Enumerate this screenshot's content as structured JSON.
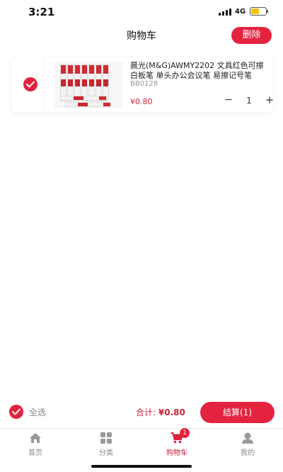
{
  "status_bar": {
    "time": "3:21",
    "network": "4G",
    "battery_level": 0.55,
    "battery_color": "#f2c200"
  },
  "header": {
    "title": "购物车",
    "delete_label": "删除"
  },
  "cart": {
    "items": [
      {
        "selected": true,
        "name": "晨光(M&G)AWMY2202 文具红色可擦白板笔 单头办公会议笔 易擦记号笔",
        "sku": "BB0128",
        "price_symbol": "¥",
        "price": "0.80",
        "qty_minus": "−",
        "quantity": "1",
        "qty_plus": "+"
      }
    ]
  },
  "checkout": {
    "select_all_label": "全选",
    "select_all_checked": true,
    "total_label": "合计:",
    "total_value": "¥0.80",
    "checkout_label": "结算(1)"
  },
  "tab_bar": {
    "tabs": [
      {
        "label": "首页",
        "icon": "home-icon"
      },
      {
        "label": "分类",
        "icon": "category-grid-icon"
      },
      {
        "label": "购物车",
        "icon": "shopping-cart-icon",
        "badge": "1",
        "active": true
      },
      {
        "label": "我的",
        "icon": "user-icon"
      }
    ]
  },
  "colors": {
    "accent": "#e4233f",
    "price": "#d8243a",
    "inactive_tab": "#888888"
  }
}
